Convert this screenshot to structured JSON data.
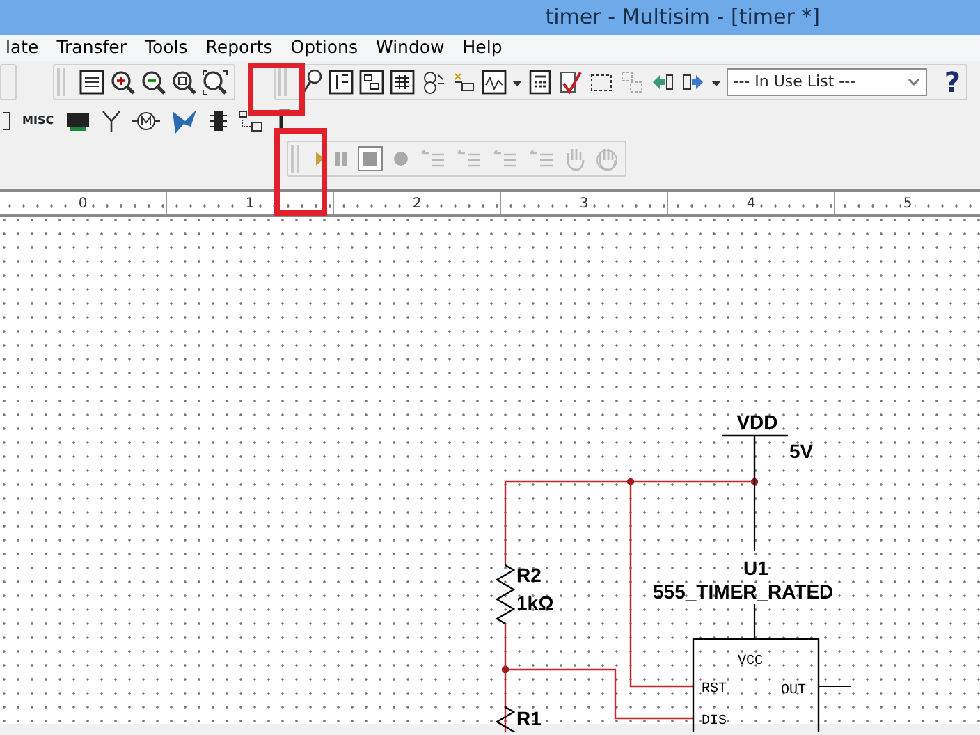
{
  "window": {
    "title": "timer - Multisim - [timer *]"
  },
  "menu": [
    {
      "label": "late"
    },
    {
      "label": "Transfer"
    },
    {
      "label": "Tools"
    },
    {
      "label": "Reports"
    },
    {
      "label": "Options"
    },
    {
      "label": "Window"
    },
    {
      "label": "Help"
    }
  ],
  "toolbars": [
    {
      "kind": "view"
    },
    {
      "kind": "main",
      "highlighted": true,
      "in_use_list": {
        "value": "--- In Use List ---"
      },
      "help": "?"
    },
    {
      "kind": "components",
      "misc": "MISC"
    },
    {
      "kind": "simulation",
      "highlighted": true
    }
  ],
  "ruler": {
    "labels": [
      "0",
      "1",
      "2",
      "3",
      "4",
      "5"
    ]
  },
  "schematic": {
    "supply": {
      "label": "VDD",
      "value": "5V"
    },
    "resistors": [
      {
        "label": "R2",
        "value": "1kΩ"
      },
      {
        "label": "R1"
      }
    ],
    "chip": {
      "ref": "U1",
      "part": "555_TIMER_RATED",
      "pins": [
        "VCC",
        "RST",
        "DIS",
        "OUT"
      ]
    }
  }
}
